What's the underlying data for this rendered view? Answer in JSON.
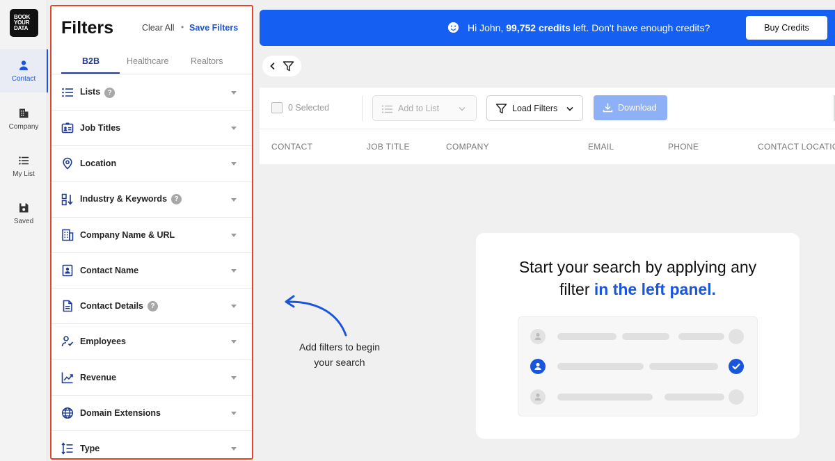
{
  "logo": {
    "line1": "BOOK",
    "line2": "YOUR",
    "line3": "DATA"
  },
  "rail": [
    {
      "label": "Contact",
      "icon": "person-icon",
      "active": true
    },
    {
      "label": "Company",
      "icon": "building-icon"
    },
    {
      "label": "My List",
      "icon": "list-icon"
    },
    {
      "label": "Saved",
      "icon": "save-icon"
    }
  ],
  "filters": {
    "title": "Filters",
    "clear_all": "Clear All",
    "separator": "•",
    "save_filters": "Save Filters",
    "tabs": [
      "B2B",
      "Healthcare",
      "Realtors"
    ],
    "items": [
      {
        "label": "Lists",
        "icon": "list-icon",
        "help": true
      },
      {
        "label": "Job Titles",
        "icon": "id-card-icon"
      },
      {
        "label": "Location",
        "icon": "location-pin-icon"
      },
      {
        "label": "Industry & Keywords",
        "icon": "industry-sort-icon",
        "help": true
      },
      {
        "label": "Company Name & URL",
        "icon": "building-icon"
      },
      {
        "label": "Contact Name",
        "icon": "contact-book-icon"
      },
      {
        "label": "Contact Details",
        "icon": "document-icon",
        "help": true
      },
      {
        "label": "Employees",
        "icon": "employee-icon"
      },
      {
        "label": "Revenue",
        "icon": "trend-chart-icon"
      },
      {
        "label": "Domain Extensions",
        "icon": "globe-icon"
      },
      {
        "label": "Type",
        "icon": "type-sort-icon"
      }
    ],
    "help_mark": "?"
  },
  "banner": {
    "greeting": "Hi John, ",
    "credits": "99,752 credits",
    "rest": " left. Don't have enough credits?",
    "buy_label": "Buy Credits"
  },
  "toolbar": {
    "selected": "0 Selected",
    "add_to_list": "Add to List",
    "load_filters": "Load Filters",
    "download": "Download"
  },
  "table": {
    "headers": [
      "CONTACT",
      "JOB TITLE",
      "COMPANY",
      "EMAIL",
      "PHONE",
      "CONTACT LOCATION"
    ]
  },
  "hint": {
    "line1": "Add filters to begin",
    "line2": "your search"
  },
  "card": {
    "title_part1": "Start your search by applying any",
    "title_part2": "filter ",
    "title_highlight": "in the left panel."
  },
  "colors": {
    "accent": "#1a56db",
    "banner": "#1560f2",
    "panel_outline": "#e2442b"
  }
}
